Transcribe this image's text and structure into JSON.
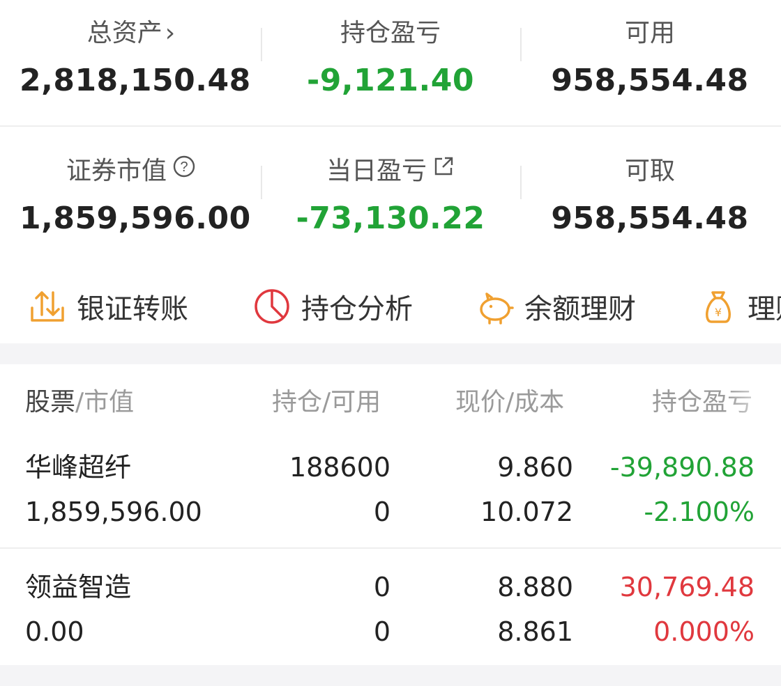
{
  "summary": {
    "total_assets": {
      "label": "总资产",
      "value": "2,818,150.48"
    },
    "position_pnl": {
      "label": "持仓盈亏",
      "value": "-9,121.40"
    },
    "available": {
      "label": "可用",
      "value": "958,554.48"
    },
    "securities_value": {
      "label": "证券市值",
      "value": "1,859,596.00"
    },
    "daily_pnl": {
      "label": "当日盈亏",
      "value": "-73,130.22"
    },
    "withdrawable": {
      "label": "可取",
      "value": "958,554.48"
    }
  },
  "actions": [
    {
      "label": "银证转账",
      "icon": "transfer-icon"
    },
    {
      "label": "持仓分析",
      "icon": "pie-chart-icon"
    },
    {
      "label": "余额理财",
      "icon": "piggy-bank-icon"
    },
    {
      "label": "理财",
      "icon": "money-bag-icon"
    }
  ],
  "table": {
    "headers": [
      {
        "main": "股票",
        "sub": "市值"
      },
      {
        "main": "持仓",
        "sub": "可用"
      },
      {
        "main": "现价",
        "sub": "成本"
      },
      {
        "main": "持仓盈亏"
      }
    ],
    "rows": [
      {
        "name": "华峰超纤",
        "market_value": "1,859,596.00",
        "position": "188600",
        "available": "0",
        "price": "9.860",
        "cost": "10.072",
        "pnl": "-39,890.88",
        "pnl_pct": "-2.100%",
        "status": "loss"
      },
      {
        "name": "领益智造",
        "market_value": "0.00",
        "position": "0",
        "available": "0",
        "price": "8.880",
        "cost": "8.861",
        "pnl": "30,769.48",
        "pnl_pct": "0.000%",
        "status": "gain"
      }
    ]
  },
  "colors": {
    "loss": "#21a336",
    "gain": "#e0383e",
    "accent": "#f0a030"
  }
}
